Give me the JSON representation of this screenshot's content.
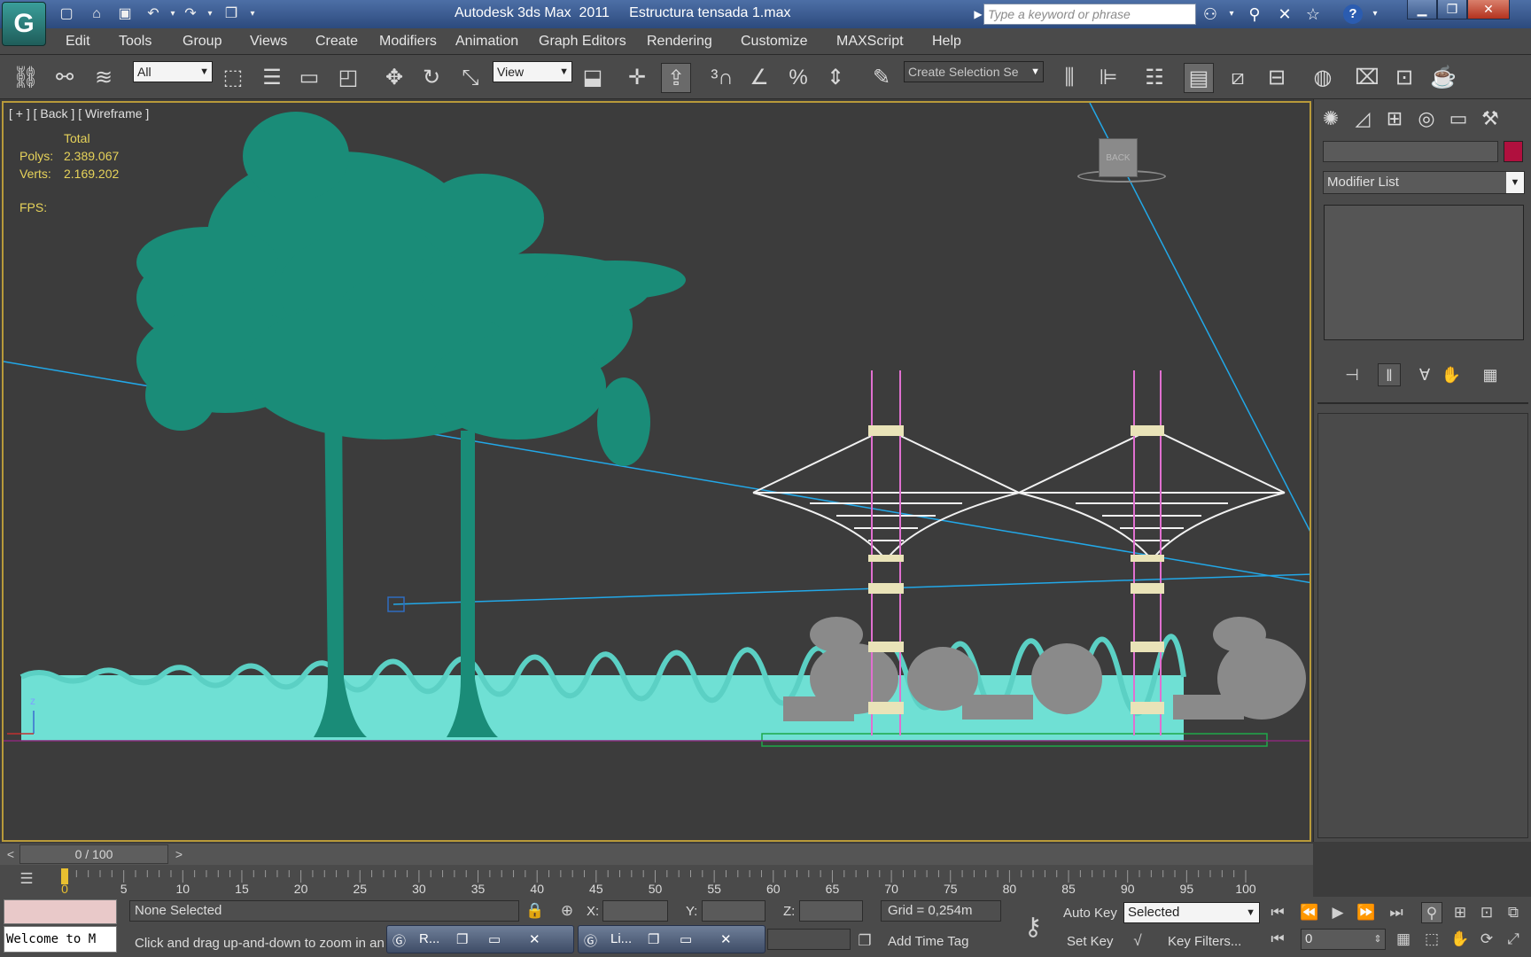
{
  "titlebar": {
    "app_name": "Autodesk 3ds Max  2011",
    "file_name": "Estructura tensada 1.max",
    "search_placeholder": "Type a keyword or phrase"
  },
  "menu": [
    "Edit",
    "Tools",
    "Group",
    "Views",
    "Create",
    "Modifiers",
    "Animation",
    "Graph Editors",
    "Rendering",
    "Customize",
    "MAXScript",
    "Help"
  ],
  "toolbar": {
    "filter_value": "All",
    "ref_coord_value": "View",
    "named_selection_placeholder": "Create Selection Se"
  },
  "viewport": {
    "label": "[ + ] [ Back ] [ Wireframe ]",
    "stats_total_label": "Total",
    "polys_label": "Polys:",
    "polys_value": "2.389.067",
    "verts_label": "Verts:",
    "verts_value": "2.169.202",
    "fps_label": "FPS:",
    "viewcube_face": "BACK",
    "axis_z": "z"
  },
  "command_panel": {
    "modifier_list_label": "Modifier List",
    "object_color": "#b0103e"
  },
  "timeline": {
    "frame_display": "0 / 100",
    "ticks": [
      "0",
      "5",
      "10",
      "15",
      "20",
      "25",
      "30",
      "35",
      "40",
      "45",
      "50",
      "55",
      "60",
      "65",
      "70",
      "75",
      "80",
      "85",
      "90",
      "95",
      "100"
    ]
  },
  "status": {
    "maxscript_text": "Welcome to M",
    "selection_status": "None Selected",
    "prompt": "Click and drag up-and-down to zoom in and",
    "x_label": "X:",
    "y_label": "Y:",
    "z_label": "Z:",
    "grid": "Grid = 0,254m",
    "add_time_tag": "Add Time Tag",
    "auto_key": "Auto Key",
    "set_key": "Set Key",
    "key_mode_value": "Selected",
    "key_filters": "Key Filters...",
    "current_frame": "0",
    "taskbar_1": "R...",
    "taskbar_2": "Li..."
  },
  "colors": {
    "palm": "#1a8c78",
    "grass": "#6fe0d4",
    "structure": "#f2f2f2",
    "masts": "#e070d0",
    "camera_lines": "#22a8e8",
    "viewport_border": "#b89a3a",
    "stats_text": "#e7d35a"
  }
}
